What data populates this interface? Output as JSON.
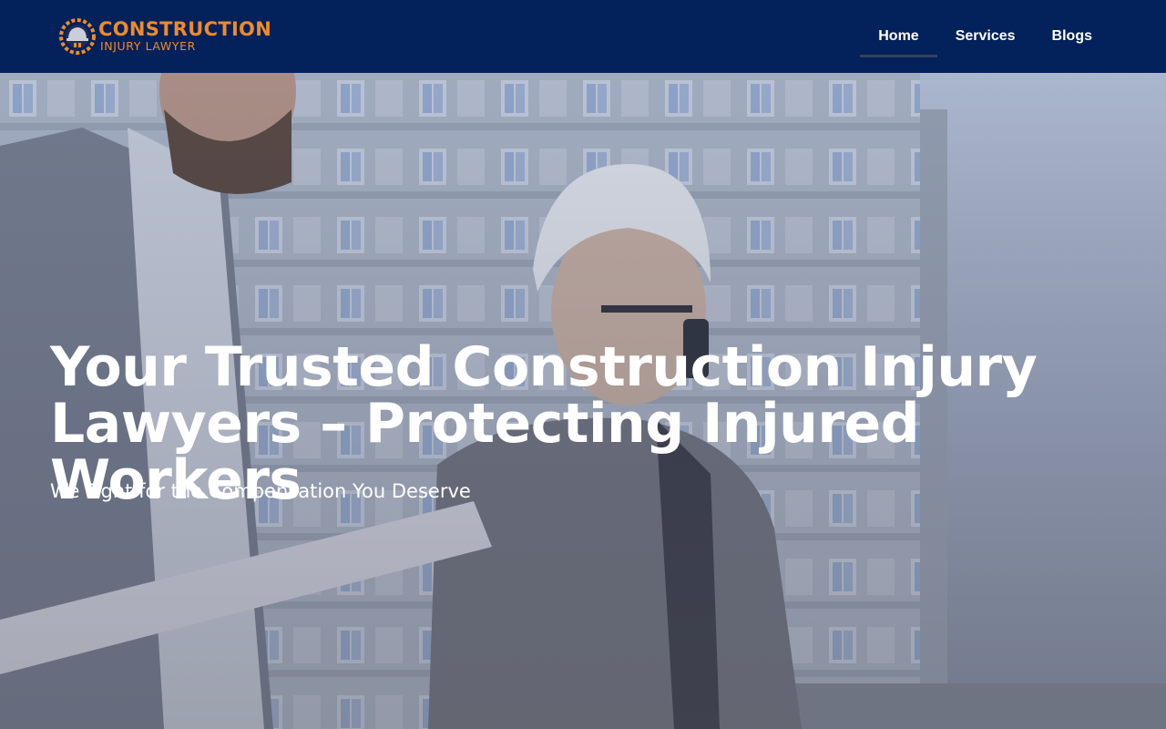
{
  "brand": {
    "name": "CONSTRUCTION",
    "tagline": "INJURY LAWYER",
    "accent_color": "#ef8a2c",
    "header_color": "#03215a"
  },
  "nav": {
    "items": [
      {
        "label": "Home",
        "active": true
      },
      {
        "label": "Services",
        "active": false
      },
      {
        "label": "Blogs",
        "active": false
      }
    ]
  },
  "hero": {
    "title": "Your Trusted Construction Injury Lawyers – Protecting Injured Workers",
    "subtitle": "We Fight for the Compensation You Deserve"
  }
}
